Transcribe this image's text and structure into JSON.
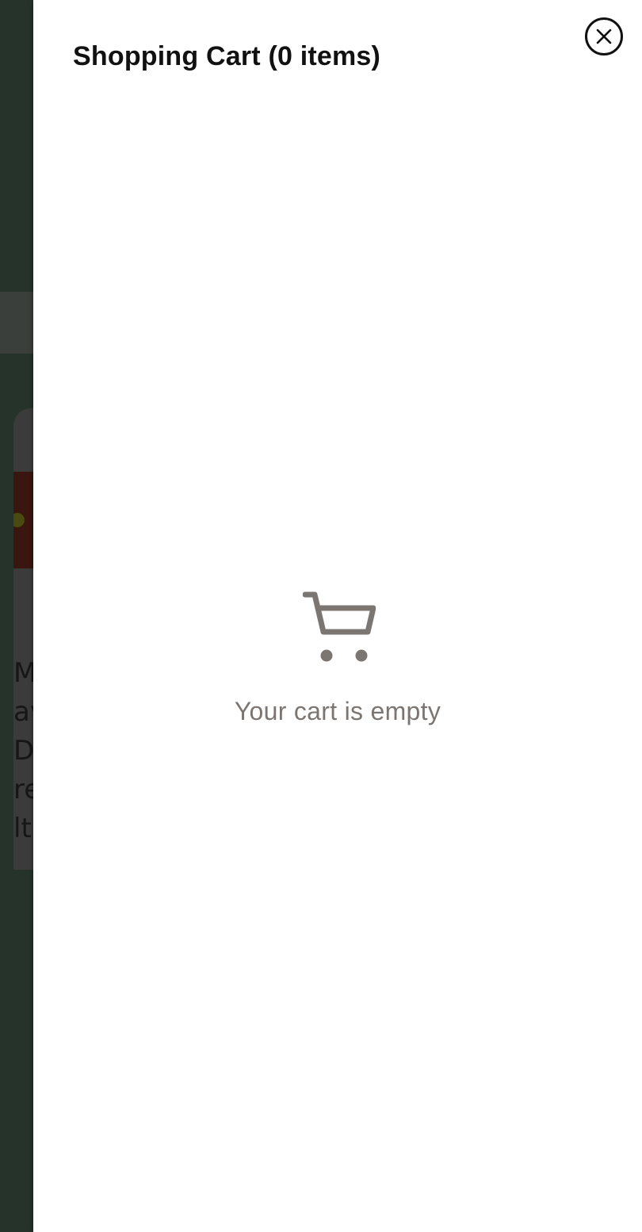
{
  "background_page": {
    "text_fragments": [
      "ML",
      "av",
      "DE",
      "re",
      "lt"
    ]
  },
  "cart_drawer": {
    "title": "Shopping Cart (0 items)",
    "close_icon": "close-icon",
    "empty_icon": "shopping-cart-icon",
    "empty_message": "Your cart is empty",
    "colors": {
      "overlay": "#25332a",
      "drawer_bg": "#ffffff",
      "muted_text": "#7c7672",
      "title_text": "#111111"
    }
  }
}
